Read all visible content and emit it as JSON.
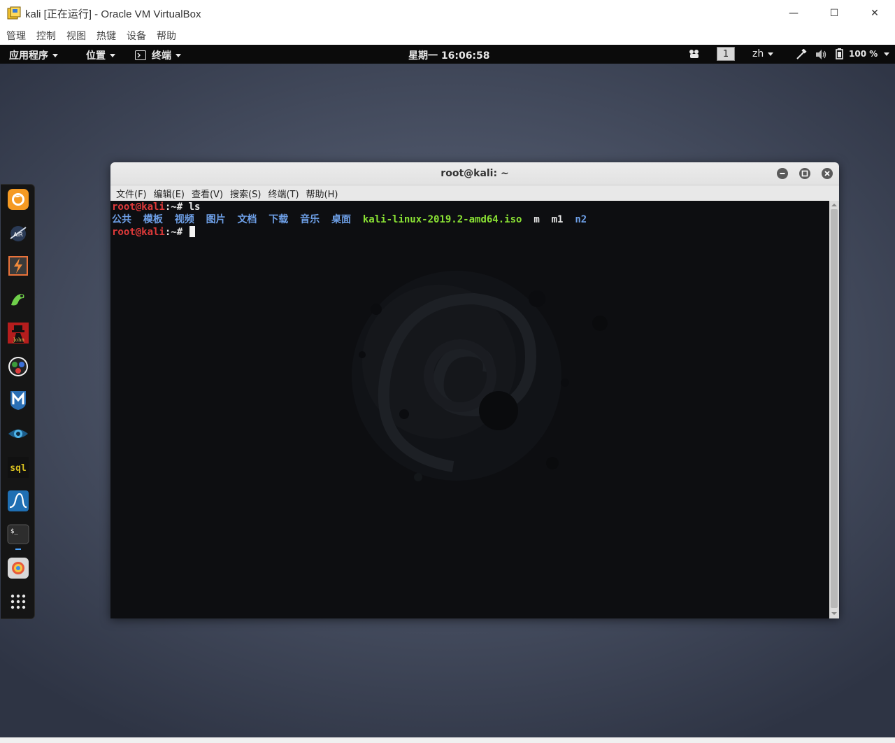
{
  "host_window": {
    "title": "kali [正在运行] - Oracle VM VirtualBox",
    "controls": {
      "minimize": "—",
      "maximize": "☐",
      "close": "✕"
    },
    "menu": [
      "管理",
      "控制",
      "视图",
      "热键",
      "设备",
      "帮助"
    ]
  },
  "panel": {
    "applications": "应用程序",
    "places": "位置",
    "terminal_app": "终端",
    "clock": "星期一 16:06:58",
    "workspace": "1",
    "input_method": "zh",
    "battery": "100 %"
  },
  "dock": {
    "icons": [
      "firefox-icon",
      "aircrack-icon",
      "burpsuite-icon",
      "armitage-icon",
      "john-icon",
      "maltego-icon",
      "metasploit-icon",
      "faraday-icon",
      "sqlmap-icon",
      "wireshark-icon",
      "terminal-icon",
      "files-icon",
      "show-applications-icon"
    ]
  },
  "terminal": {
    "title": "root@kali: ~",
    "menu": [
      "文件(F)",
      "编辑(E)",
      "查看(V)",
      "搜索(S)",
      "终端(T)",
      "帮助(H)"
    ],
    "prompt_user": "root@kali",
    "prompt_suffix": ":~# ",
    "command": "ls",
    "ls_dirs": [
      "公共",
      "模板",
      "视频",
      "图片",
      "文档",
      "下载",
      "音乐",
      "桌面"
    ],
    "ls_iso": "kali-linux-2019.2-amd64.iso",
    "ls_files": [
      "m",
      "m1"
    ],
    "ls_dir_last": "n2"
  },
  "colors": {
    "prompt": "#e03a3a",
    "directory": "#6ea0e8",
    "archive": "#8ae234",
    "text": "#e8e8e8"
  }
}
